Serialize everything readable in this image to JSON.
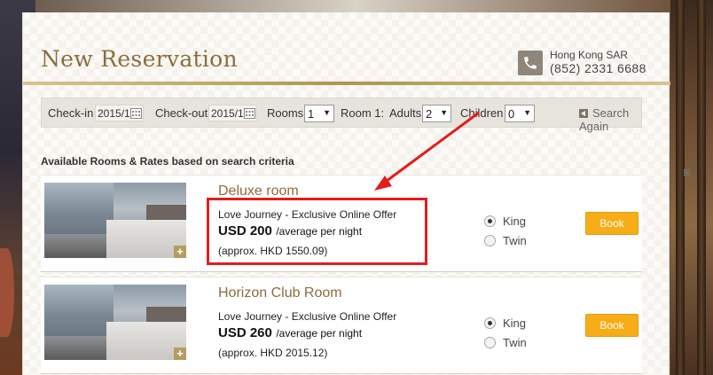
{
  "header": {
    "title": "New Reservation",
    "city": "Hong Kong SAR",
    "phone": "(852) 2331 6688"
  },
  "search": {
    "checkin_label": "Check-in",
    "checkin_value": "2015/1",
    "checkout_label": "Check-out",
    "checkout_value": "2015/1",
    "rooms_label": "Rooms",
    "rooms_value": "1",
    "room1_label": "Room 1:",
    "adults_label": "Adults",
    "adults_value": "2",
    "children_label": "Children",
    "children_value": "0",
    "search_again": "Search Again"
  },
  "section_title": "Available Rooms & Rates based on search criteria",
  "rooms": [
    {
      "name": "Deluxe room",
      "offer": "Love Journey - Exclusive Online Offer",
      "price": "USD 200",
      "price_note": "/average per night",
      "approx": "(approx. HKD 1550.09)",
      "bed_options": [
        "King",
        "Twin"
      ],
      "selected_bed": "King",
      "book_label": "Book"
    },
    {
      "name": "Horizon Club Room",
      "offer": "Love Journey - Exclusive Online Offer",
      "price": "USD 260",
      "price_note": "/average per night",
      "approx": "(approx. HKD 2015.12)",
      "bed_options": [
        "King",
        "Twin"
      ],
      "selected_bed": "King",
      "book_label": "Book"
    }
  ],
  "colors": {
    "accent_gold": "#8b6d3f",
    "book_button": "#f7ad17",
    "annotation_red": "#e31d1d"
  }
}
